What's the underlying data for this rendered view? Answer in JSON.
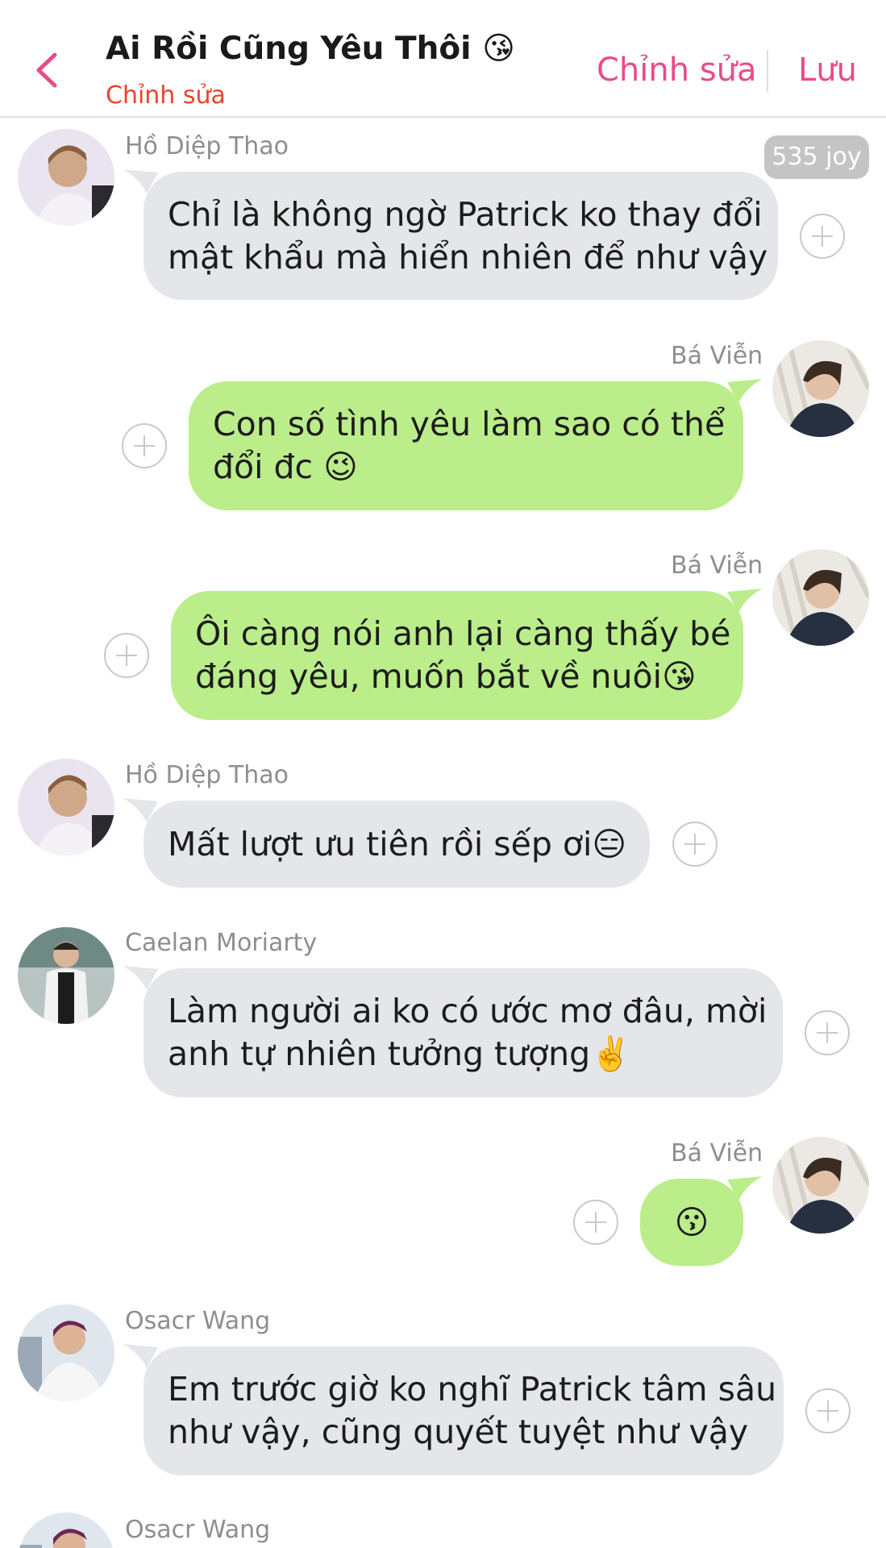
{
  "header": {
    "title": "Ai Rồi Cũng Yêu Thôi 😘",
    "subtitle": "Chỉnh sửa",
    "edit_label": "Chỉnh sửa",
    "save_label": "Lưu"
  },
  "joy_badge": "535 joy",
  "messages": [
    {
      "sender": "Hồ Diệp Thao",
      "lines": [
        "Chỉ là không ngờ Patrick ko thay đổi",
        "mật khẩu mà hiển nhiên để như vậy"
      ]
    },
    {
      "sender": "Bá Viễn",
      "lines": [
        "Con số tình yêu làm sao có thể",
        "đổi đc 😉"
      ]
    },
    {
      "sender": "Bá Viễn",
      "lines": [
        "Ôi càng nói anh lại càng thấy bé",
        "đáng yêu, muốn bắt về nuôi😘"
      ]
    },
    {
      "sender": "Hồ Diệp Thao",
      "lines": [
        "Mất lượt ưu tiên rồi sếp ơi😑"
      ]
    },
    {
      "sender": "Caelan Moriarty",
      "lines": [
        "Làm người ai ko có ước mơ đâu, mời",
        "anh tự nhiên tưởng tượng✌️"
      ]
    },
    {
      "sender": "Bá Viễn",
      "lines": [
        "😗"
      ]
    },
    {
      "sender": "Osacr Wang",
      "lines": [
        "Em trước giờ ko nghĩ Patrick tâm sâu",
        "như vậy, cũng quyết tuyệt như vậy"
      ]
    },
    {
      "sender": "Osacr Wang",
      "lines": []
    }
  ],
  "colors": {
    "accent": "#e94b8a",
    "subtitle": "#e8442d",
    "incoming_bubble": "#e4e6ea",
    "outgoing_bubble": "#bbed8a"
  }
}
